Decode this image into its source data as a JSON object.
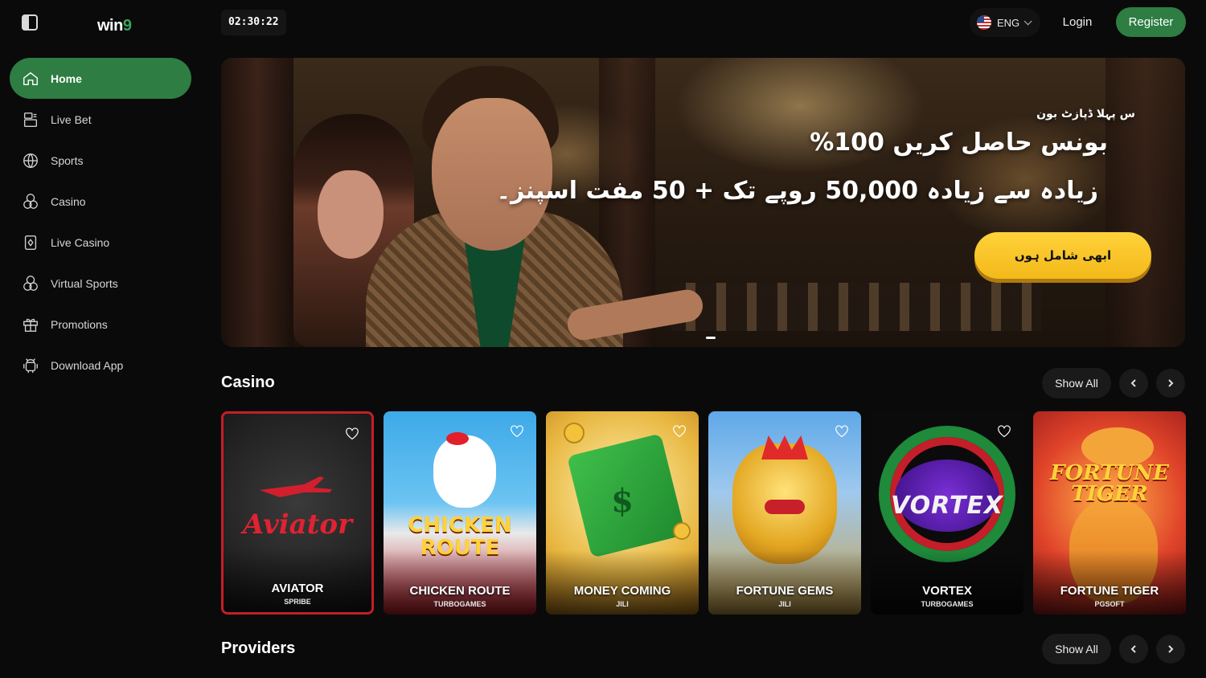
{
  "brand": {
    "logo_text": "win",
    "logo_digit": "9"
  },
  "header": {
    "clock": "02:30:22",
    "language": "ENG",
    "login_label": "Login",
    "register_label": "Register"
  },
  "sidebar": {
    "items": [
      {
        "label": "Home",
        "icon": "home-icon",
        "active": true
      },
      {
        "label": "Live Bet",
        "icon": "live-bet-icon"
      },
      {
        "label": "Sports",
        "icon": "sports-ball-icon"
      },
      {
        "label": "Casino",
        "icon": "casino-chips-icon"
      },
      {
        "label": "Live Casino",
        "icon": "live-casino-card-icon"
      },
      {
        "label": "Virtual Sports",
        "icon": "virtual-sports-icon"
      },
      {
        "label": "Promotions",
        "icon": "gift-icon"
      },
      {
        "label": "Download App",
        "icon": "android-icon"
      }
    ]
  },
  "banner": {
    "line1": "س پہلا ڈپازٹ بون",
    "line2": "بونس حاصل کریں 100%",
    "line3": "زیادہ سے زیادہ 50,000 روپے تک + 50 مفت اسپنز۔",
    "cta_label": "ابھی شامل ہوں"
  },
  "casino": {
    "title": "Casino",
    "show_all_label": "Show All",
    "games": [
      {
        "name": "AVIATOR",
        "provider": "SPRIBE",
        "art_text": "Aviator"
      },
      {
        "name": "CHICKEN ROUTE",
        "provider": "TURBOGAMES",
        "art_text": "CHICKEN ROUTE"
      },
      {
        "name": "MONEY COMING",
        "provider": "JILI",
        "art_text": "$"
      },
      {
        "name": "FORTUNE GEMS",
        "provider": "JILI",
        "art_text": ""
      },
      {
        "name": "VORTEX",
        "provider": "TURBOGAMES",
        "art_text": "VORTEX"
      },
      {
        "name": "FORTUNE TIGER",
        "provider": "PGSOFT",
        "art_text": "FORTUNE TIGER"
      }
    ]
  },
  "providers": {
    "title": "Providers",
    "show_all_label": "Show All"
  },
  "colors": {
    "accent_green": "#2e7d42",
    "cta_yellow": "#ffd23a",
    "background": "#0a0a0a"
  }
}
